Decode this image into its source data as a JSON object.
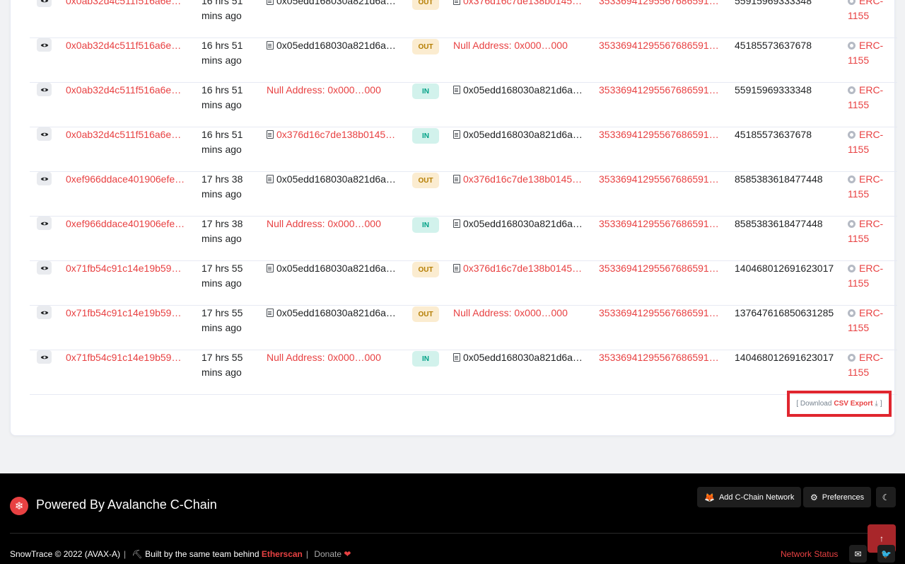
{
  "rows": [
    {
      "txhash": "0x0ab32d4c511f516a6e…",
      "age": "16 hrs 51 mins ago",
      "from": "0x05edd168030a821d6a…",
      "from_type": "contract",
      "dir": "OUT",
      "to": "0x376d16c7de138b0145…",
      "to_type": "contract-link",
      "tokenid": "35336941295567686591…",
      "value": "55915969333348",
      "token": "ERC-1155"
    },
    {
      "txhash": "0x0ab32d4c511f516a6e…",
      "age": "16 hrs 51 mins ago",
      "from": "0x05edd168030a821d6a…",
      "from_type": "contract",
      "dir": "OUT",
      "to": "Null Address: 0x000…000",
      "to_type": "null",
      "tokenid": "35336941295567686591…",
      "value": "45185573637678",
      "token": "ERC-1155"
    },
    {
      "txhash": "0x0ab32d4c511f516a6e…",
      "age": "16 hrs 51 mins ago",
      "from": "Null Address: 0x000…000",
      "from_type": "null",
      "dir": "IN",
      "to": "0x05edd168030a821d6a…",
      "to_type": "contract",
      "tokenid": "35336941295567686591…",
      "value": "55915969333348",
      "token": "ERC-1155"
    },
    {
      "txhash": "0x0ab32d4c511f516a6e…",
      "age": "16 hrs 51 mins ago",
      "from": "0x376d16c7de138b0145…",
      "from_type": "contract-link",
      "dir": "IN",
      "to": "0x05edd168030a821d6a…",
      "to_type": "contract",
      "tokenid": "35336941295567686591…",
      "value": "45185573637678",
      "token": "ERC-1155"
    },
    {
      "txhash": "0xef966ddace401906efe…",
      "age": "17 hrs 38 mins ago",
      "from": "0x05edd168030a821d6a…",
      "from_type": "contract",
      "dir": "OUT",
      "to": "0x376d16c7de138b0145…",
      "to_type": "contract-link",
      "tokenid": "35336941295567686591…",
      "value": "8585383618477448",
      "token": "ERC-1155"
    },
    {
      "txhash": "0xef966ddace401906efe…",
      "age": "17 hrs 38 mins ago",
      "from": "Null Address: 0x000…000",
      "from_type": "null",
      "dir": "IN",
      "to": "0x05edd168030a821d6a…",
      "to_type": "contract",
      "tokenid": "35336941295567686591…",
      "value": "8585383618477448",
      "token": "ERC-1155"
    },
    {
      "txhash": "0x71fb54c91c14e19b59…",
      "age": "17 hrs 55 mins ago",
      "from": "0x05edd168030a821d6a…",
      "from_type": "contract",
      "dir": "OUT",
      "to": "0x376d16c7de138b0145…",
      "to_type": "contract-link",
      "tokenid": "35336941295567686591…",
      "value": "140468012691623017",
      "token": "ERC-1155"
    },
    {
      "txhash": "0x71fb54c91c14e19b59…",
      "age": "17 hrs 55 mins ago",
      "from": "0x05edd168030a821d6a…",
      "from_type": "contract",
      "dir": "OUT",
      "to": "Null Address: 0x000…000",
      "to_type": "null",
      "tokenid": "35336941295567686591…",
      "value": "137647616850631285",
      "token": "ERC-1155"
    },
    {
      "txhash": "0x71fb54c91c14e19b59…",
      "age": "17 hrs 55 mins ago",
      "from": "Null Address: 0x000…000",
      "from_type": "null",
      "dir": "IN",
      "to": "0x05edd168030a821d6a…",
      "to_type": "contract",
      "tokenid": "35336941295567686591…",
      "value": "140468012691623017",
      "token": "ERC-1155"
    }
  ],
  "csv": {
    "prefix": "[ Download",
    "link": "CSV Export",
    "suffix": "]"
  },
  "footer": {
    "powered": "Powered By Avalanche C-Chain",
    "add_network": "Add C-Chain Network",
    "preferences": "Preferences",
    "copyright": "SnowTrace © 2022 (AVAX-A)",
    "built_by": "Built by the same team behind",
    "etherscan": "Etherscan",
    "donate": "Donate",
    "network_status": "Network Status"
  },
  "colors": {
    "accent": "#e84142",
    "out_bg": "#fbecd0",
    "in_bg": "#d2f2ec"
  },
  "icons": {
    "row_view": "eye-icon",
    "contract": "file-text-icon",
    "token": "coin-icon",
    "download": "download-icon",
    "theme": "moon-icon",
    "email": "envelope-icon",
    "twitter": "twitter-icon",
    "back_to_top": "arrow-up-icon"
  }
}
